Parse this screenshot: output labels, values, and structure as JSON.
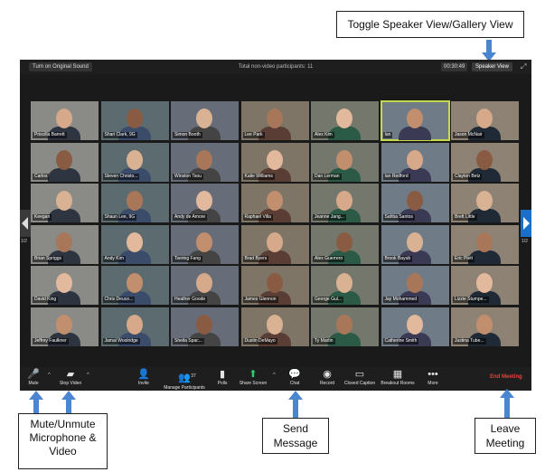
{
  "callouts": {
    "top": "Toggle Speaker View/Gallery View",
    "mute": [
      "Mute/Unmute",
      "Microphone &",
      "Video"
    ],
    "send": [
      "Send",
      "Message"
    ],
    "leave": [
      "Leave",
      "Meeting"
    ]
  },
  "window": {
    "original_sound": "Turn on Original Sound",
    "participants_title": "Total non-video participants: 11",
    "timer": "00:30:49",
    "speaker_view": "Speaker View",
    "page_left": "1/2",
    "page_right": "1/2"
  },
  "participants": [
    "Priscilla Barrett",
    "Shari Clark, 9G",
    "Simon Booth",
    "Lee Park",
    "Alex Kim",
    "Ian",
    "Jason McNair",
    "Carlos",
    "Steven Christo...",
    "Winston Tsou",
    "Katie Williams",
    "Dan Lerman",
    "Ian Redford",
    "Clayton Betz",
    "Keegan",
    "Shaun Lee, 9G",
    "Andy de Amore",
    "Raphael Villa",
    "Jeanne Jang...",
    "Sahba Santos",
    "Brett Little",
    "Brian Spriggs",
    "Andy Kim",
    "Tsering Fang",
    "Brad Byers",
    "Alex Guerrero",
    "Brook Bayub",
    "Eric Plett",
    "David King",
    "Chris Deuce...",
    "Heather Goode",
    "James Glennon",
    "George Gul...",
    "Jay Mohammed",
    "Lizzie Stumpe...",
    "Jeffrey Faulkner",
    "Jamal Woolridge",
    "Sheila Spac...",
    "Dustin DeMayo",
    "Ty Martin",
    "Catherine Smith",
    "Justina Tube..."
  ],
  "active_tile_index": 5,
  "toolbar": {
    "mute": "Mute",
    "stop_video": "Stop Video",
    "invite": "Invite",
    "manage_participants": "Manage Participants",
    "participant_count": "37",
    "polls": "Polls",
    "share_screen": "Share Screen",
    "chat": "Chat",
    "record": "Record",
    "closed_caption": "Closed Caption",
    "breakout_rooms": "Breakout Rooms",
    "more": "More",
    "end_meeting": "End Meeting"
  },
  "icons": {
    "mic": "microphone-icon",
    "video": "video-camera-icon",
    "invite": "invite-icon",
    "participants": "participants-icon",
    "polls": "polls-icon",
    "share": "share-screen-icon",
    "chat": "chat-bubble-icon",
    "record": "record-icon",
    "cc": "closed-caption-icon",
    "breakout": "breakout-rooms-icon",
    "more": "more-dots-icon"
  },
  "colors": {
    "arrow": "#4a86d0",
    "end_meeting": "#e8423a",
    "active_speaker": "#c6d94a",
    "nav_right": "#1b6fc9"
  }
}
